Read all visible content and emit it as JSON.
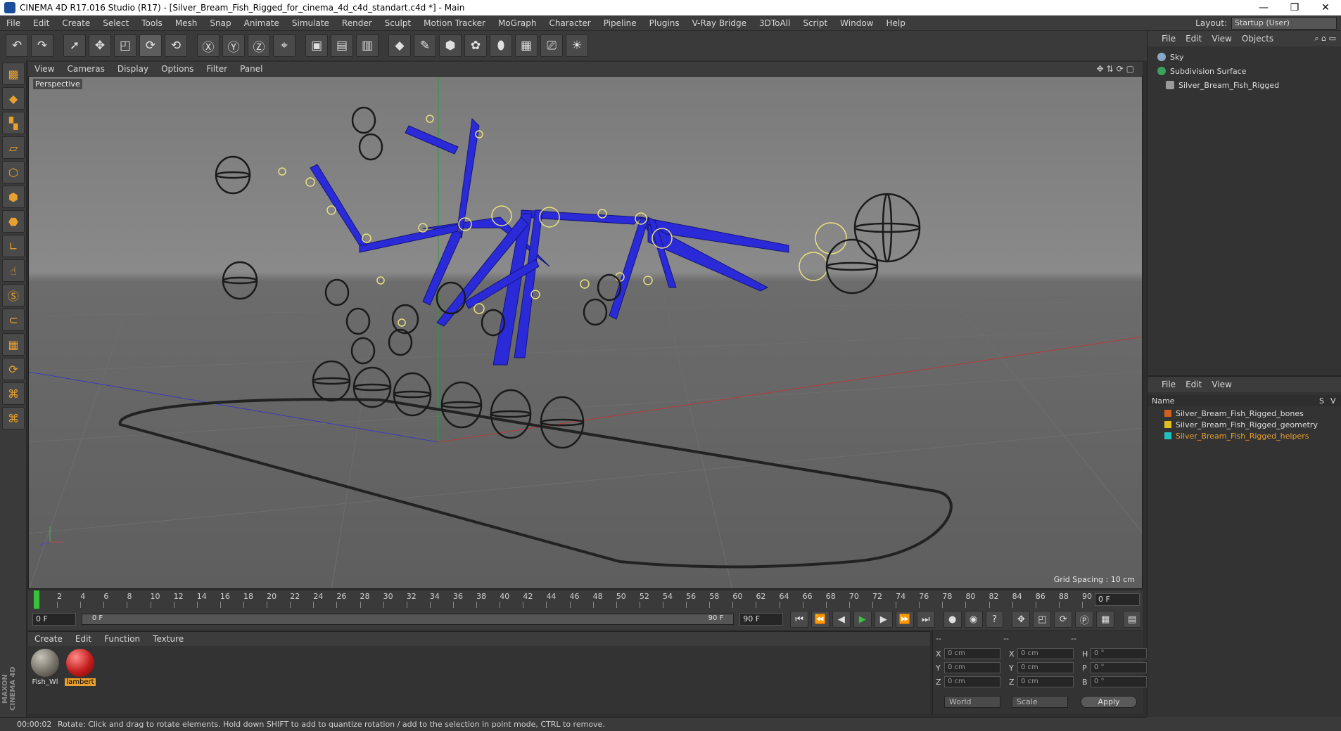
{
  "window": {
    "title": "CINEMA 4D R17.016 Studio (R17) - [Silver_Bream_Fish_Rigged_for_cinema_4d_c4d_standart.c4d *] - Main",
    "minimize": "—",
    "restore": "❐",
    "close": "✕"
  },
  "menu": [
    "File",
    "Edit",
    "Create",
    "Select",
    "Tools",
    "Mesh",
    "Snap",
    "Animate",
    "Simulate",
    "Render",
    "Sculpt",
    "Motion Tracker",
    "MoGraph",
    "Character",
    "Pipeline",
    "Plugins",
    "V-Ray Bridge",
    "3DToAll",
    "Script",
    "Window",
    "Help"
  ],
  "layout": {
    "label": "Layout:",
    "value": "Startup (User)"
  },
  "viewport_menu": [
    "View",
    "Cameras",
    "Display",
    "Options",
    "Filter",
    "Panel"
  ],
  "viewport": {
    "label": "Perspective",
    "grid_spacing": "Grid Spacing : 10 cm"
  },
  "timeline": {
    "ticks": [
      "0",
      "2",
      "4",
      "6",
      "8",
      "10",
      "12",
      "14",
      "16",
      "18",
      "20",
      "22",
      "24",
      "26",
      "28",
      "30",
      "32",
      "34",
      "36",
      "38",
      "40",
      "42",
      "44",
      "46",
      "48",
      "50",
      "52",
      "54",
      "56",
      "58",
      "60",
      "62",
      "64",
      "66",
      "68",
      "70",
      "72",
      "74",
      "76",
      "78",
      "80",
      "82",
      "84",
      "86",
      "88",
      "90"
    ],
    "current_frame": "0 F",
    "start_field": "0 F",
    "range_start": "0 F",
    "range_end": "90 F",
    "end_field": "90 F"
  },
  "material_menu": [
    "Create",
    "Edit",
    "Function",
    "Texture"
  ],
  "materials": [
    {
      "name": "Fish_Wl",
      "color": "#7a7468"
    },
    {
      "name": "lambert",
      "color": "#c41c1c"
    }
  ],
  "coords": {
    "header": [
      "--",
      "--",
      "--"
    ],
    "rows": [
      {
        "a": "X",
        "av": "0 cm",
        "b": "X",
        "bv": "0 cm",
        "c": "H",
        "cv": "0 °"
      },
      {
        "a": "Y",
        "av": "0 cm",
        "b": "Y",
        "bv": "0 cm",
        "c": "P",
        "cv": "0 °"
      },
      {
        "a": "Z",
        "av": "0 cm",
        "b": "Z",
        "bv": "0 cm",
        "c": "B",
        "cv": "0 °"
      }
    ],
    "world": "World",
    "scale": "Scale",
    "apply": "Apply"
  },
  "status": {
    "time": "00:00:02",
    "text": "Rotate: Click and drag to rotate elements. Hold down SHIFT to add to quantize rotation / add to the selection in point mode, CTRL to remove."
  },
  "object_menu": [
    "File",
    "Edit",
    "View",
    "Objects"
  ],
  "objects": [
    {
      "name": "Sky",
      "color": "#8aa6c8"
    },
    {
      "name": "Subdivision Surface",
      "color": "#3ca060"
    },
    {
      "name": "Silver_Bream_Fish_Rigged",
      "color": "#9a9a9a"
    }
  ],
  "layer_menu": [
    "File",
    "Edit",
    "View"
  ],
  "layers": {
    "header_name": "Name",
    "header_s": "S",
    "header_v": "V",
    "items": [
      {
        "name": "Silver_Bream_Fish_Rigged_bones",
        "color": "#d06020"
      },
      {
        "name": "Silver_Bream_Fish_Rigged_geometry",
        "color": "#e0c020"
      },
      {
        "name": "Silver_Bream_Fish_Rigged_helpers",
        "color": "#20c0c0"
      }
    ]
  },
  "colors": {
    "accent": "#e8a030",
    "bone": "#2a2ad8",
    "selected_layer": "#e8a030"
  }
}
